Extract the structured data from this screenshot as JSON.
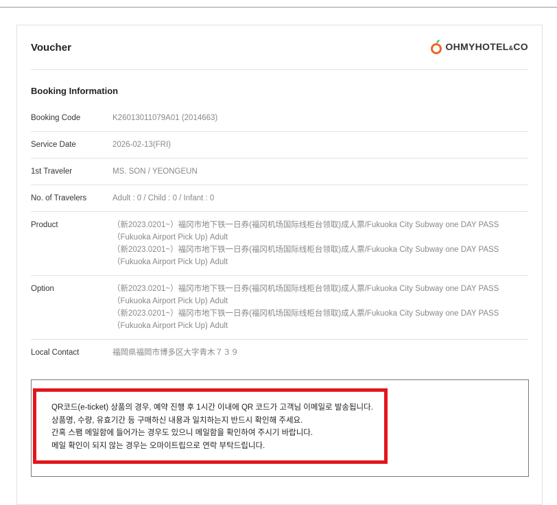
{
  "brand": {
    "logo_text": "OHMYHOTEL&CO",
    "accent": "#f0642a",
    "leaf": "#4caf50"
  },
  "header": {
    "title": "Voucher"
  },
  "section": {
    "title": "Booking Information"
  },
  "rows": [
    {
      "label": "Booking Code",
      "value": [
        "K26013011079A01 (2014663)"
      ]
    },
    {
      "label": "Service Date",
      "value": [
        "2026-02-13(FRI)"
      ]
    },
    {
      "label": "1st Traveler",
      "value": [
        "MS. SON / YEONGEUN"
      ]
    },
    {
      "label": "No. of Travelers",
      "value": [
        "Adult : 0 / Child : 0 / Infant : 0"
      ]
    },
    {
      "label": "Product",
      "value": [
        "（新2023.0201~）福冈市地下铁一日券(福冈机场国际线柜台领取)成人票/Fukuoka City Subway one DAY PASS （Fukuoka Airport Pick Up) Adult",
        "（新2023.0201~）福冈市地下铁一日券(福冈机场国际线柜台领取)成人票/Fukuoka City Subway one DAY PASS （Fukuoka Airport Pick Up) Adult"
      ]
    },
    {
      "label": "Option",
      "value": [
        "（新2023.0201~）福冈市地下铁一日券(福冈机场国际线柜台领取)成人票/Fukuoka City Subway one DAY PASS （Fukuoka Airport Pick Up) Adult",
        "（新2023.0201~）福冈市地下铁一日券(福冈机场国际线柜台领取)成人票/Fukuoka City Subway one DAY PASS （Fukuoka Airport Pick Up) Adult"
      ]
    },
    {
      "label": "Local Contact",
      "value": [
        "福岡県福岡市博多区大字青木７３９"
      ]
    }
  ],
  "notice": {
    "lines": [
      "QR코드(e-ticket) 상품의 경우, 예약 진행 후 1시간 이내에 QR 코드가 고객님 이메일로 발송됩니다.",
      "상품명, 수량, 유효기간 등 구매하신 내용과 일치하는지 반드시 확인해 주세요.",
      "간혹 스팸 메일함에 들어가는 경우도 있으니 메일함을 확인하여 주시기 바랍니다.",
      "메일 확인이 되지 않는 경우는 오마이트립으로 연락 부탁드립니다."
    ]
  }
}
